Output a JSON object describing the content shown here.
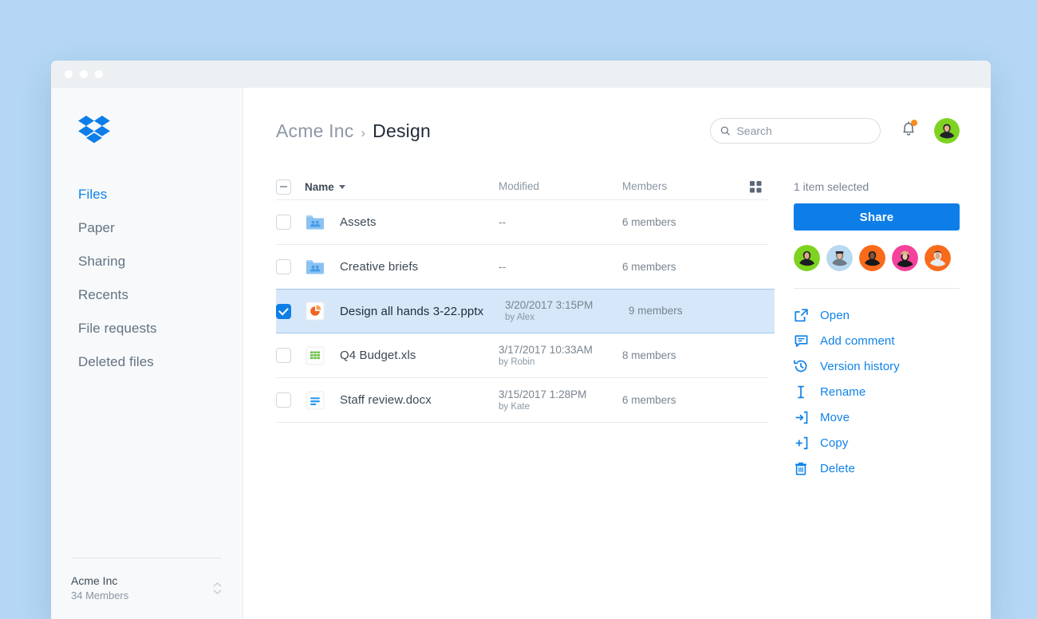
{
  "window": {
    "traffic_lights": [
      "close",
      "minimize",
      "maximize"
    ]
  },
  "sidebar": {
    "logo": "dropbox-logo",
    "items": [
      {
        "label": "Files",
        "active": true
      },
      {
        "label": "Paper",
        "active": false
      },
      {
        "label": "Sharing",
        "active": false
      },
      {
        "label": "Recents",
        "active": false
      },
      {
        "label": "File requests",
        "active": false
      },
      {
        "label": "Deleted files",
        "active": false
      }
    ],
    "team": {
      "name": "Acme Inc",
      "members": "34 Members",
      "switcher_icon": "up-down-chevrons-icon"
    }
  },
  "header": {
    "breadcrumb": {
      "parent": "Acme Inc",
      "separator": "›",
      "current": "Design"
    },
    "search": {
      "placeholder": "Search",
      "value": "",
      "icon": "search-icon"
    },
    "notifications": {
      "icon": "bell-icon",
      "has_unread": true,
      "badge_color": "#ff8c19"
    },
    "account_avatar": "user-avatar"
  },
  "table": {
    "select_all_state": "indeterminate",
    "columns": {
      "name": "Name",
      "modified": "Modified",
      "members": "Members"
    },
    "sort_caret": "caret-down-icon",
    "view_toggle_icon": "grid-view-icon",
    "rows": [
      {
        "name": "Assets",
        "icon": "shared-folder-icon",
        "modified": "--",
        "modified_by": "",
        "members": "6 members",
        "selected": false
      },
      {
        "name": "Creative briefs",
        "icon": "shared-folder-icon",
        "modified": "--",
        "modified_by": "",
        "members": "6 members",
        "selected": false
      },
      {
        "name": "Design all hands 3-22.pptx",
        "icon": "powerpoint-file-icon",
        "modified": "3/20/2017 3:15PM",
        "modified_by": "by Alex",
        "members": "9 members",
        "selected": true
      },
      {
        "name": "Q4 Budget.xls",
        "icon": "excel-file-icon",
        "modified": "3/17/2017 10:33AM",
        "modified_by": "by Robin",
        "members": "8 members",
        "selected": false
      },
      {
        "name": "Staff review.docx",
        "icon": "word-file-icon",
        "modified": "3/15/2017 1:28PM",
        "modified_by": "by Kate",
        "members": "6 members",
        "selected": false
      }
    ]
  },
  "details_panel": {
    "selection_status": "1 item selected",
    "share_label": "Share",
    "member_avatars": [
      {
        "name": "member-avatar-1",
        "bg": "#7ed321"
      },
      {
        "name": "member-avatar-2",
        "bg": "#b8d9ef"
      },
      {
        "name": "member-avatar-3",
        "bg": "#f96a1b"
      },
      {
        "name": "member-avatar-4",
        "bg": "#f5429b"
      },
      {
        "name": "member-avatar-5",
        "bg": "#f96a1b"
      }
    ],
    "actions": [
      {
        "label": "Open",
        "icon": "open-external-icon"
      },
      {
        "label": "Add comment",
        "icon": "comment-icon"
      },
      {
        "label": "Version history",
        "icon": "history-clock-icon"
      },
      {
        "label": "Rename",
        "icon": "text-cursor-icon"
      },
      {
        "label": "Move",
        "icon": "move-into-box-icon"
      },
      {
        "label": "Copy",
        "icon": "copy-into-box-icon"
      },
      {
        "label": "Delete",
        "icon": "trash-icon"
      }
    ]
  },
  "colors": {
    "accent": "#0d7ee8",
    "page_background": "#b5d7f5",
    "selected_row": "#d6e7fa",
    "sidebar_background": "#f7f9fa"
  }
}
